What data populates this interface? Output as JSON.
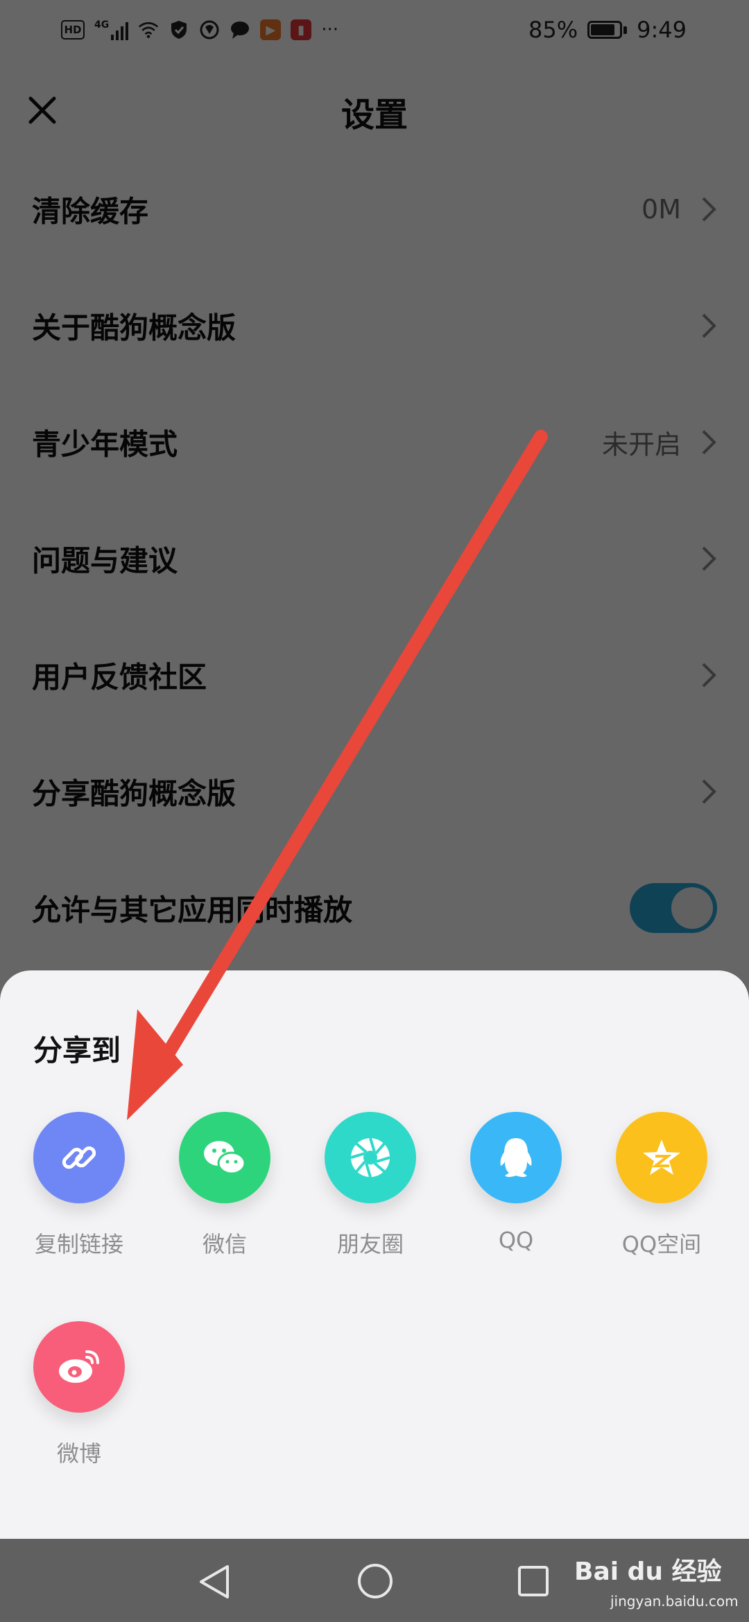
{
  "status_bar": {
    "hd": "HD",
    "network": "4G",
    "more": "···",
    "battery": "85%",
    "time": "9:49"
  },
  "header": {
    "title": "设置"
  },
  "settings": {
    "items": [
      {
        "label": "清除缓存",
        "value": "0M",
        "chevron": true
      },
      {
        "label": "关于酷狗概念版",
        "value": "",
        "chevron": true
      },
      {
        "label": "青少年模式",
        "value": "未开启",
        "chevron": true
      },
      {
        "label": "问题与建议",
        "value": "",
        "chevron": true
      },
      {
        "label": "用户反馈社区",
        "value": "",
        "chevron": true
      },
      {
        "label": "分享酷狗概念版",
        "value": "",
        "chevron": true
      },
      {
        "label": "允许与其它应用同时播放",
        "toggle": true,
        "toggle_on": true
      }
    ]
  },
  "share_sheet": {
    "title": "分享到",
    "items": [
      {
        "label": "复制链接",
        "color": "#6f86f5",
        "icon": "link-icon"
      },
      {
        "label": "微信",
        "color": "#2ed47b",
        "icon": "wechat-icon"
      },
      {
        "label": "朋友圈",
        "color": "#2fd9c9",
        "icon": "moments-icon"
      },
      {
        "label": "QQ",
        "color": "#39b7f7",
        "icon": "qq-icon"
      },
      {
        "label": "QQ空间",
        "color": "#fbc01b",
        "icon": "qzone-icon"
      },
      {
        "label": "微博",
        "color": "#f85e7a",
        "icon": "weibo-icon"
      }
    ]
  },
  "watermark": {
    "brand": "Bai du 经验",
    "url": "jingyan.baidu.com"
  },
  "colors": {
    "annotation_arrow": "#e9473a",
    "toggle_on": "#2aa5d6",
    "nav_bar": "#606060"
  }
}
